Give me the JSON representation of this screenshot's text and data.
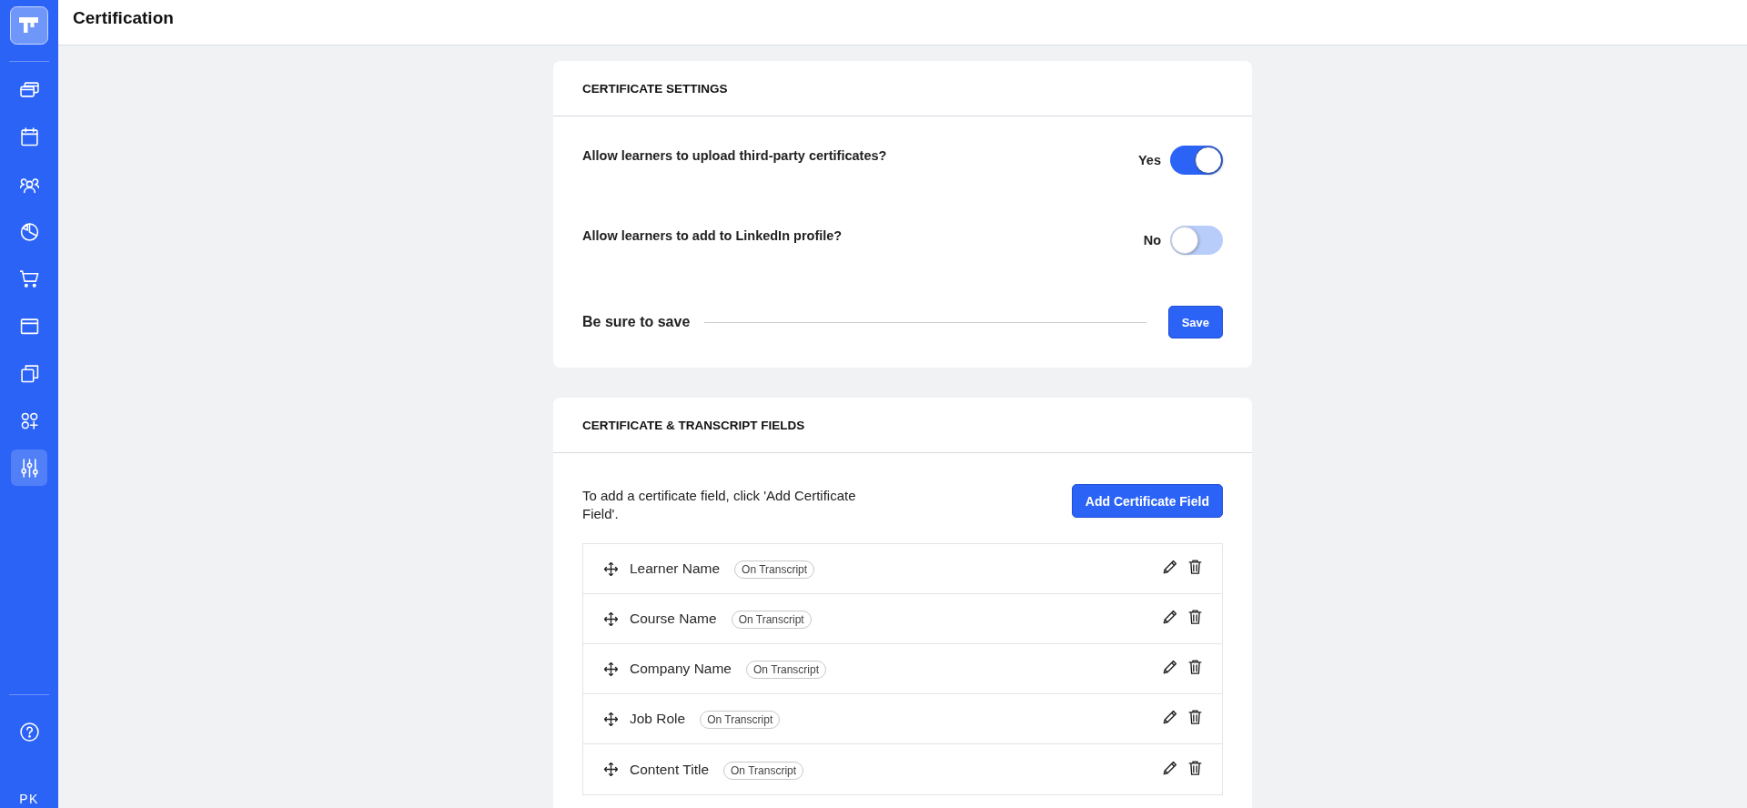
{
  "header": {
    "title": "Certification"
  },
  "sidebar": {
    "items": [
      {
        "selected": false
      },
      {
        "selected": false
      },
      {
        "selected": false
      },
      {
        "selected": false
      },
      {
        "selected": false
      },
      {
        "selected": false
      },
      {
        "selected": false
      },
      {
        "selected": false
      },
      {
        "selected": true
      }
    ],
    "user_initials": "PK"
  },
  "settings_card": {
    "title": "CERTIFICATE SETTINGS",
    "options": [
      {
        "label": "Allow learners to upload third-party certificates?",
        "state_text": "Yes",
        "on": true
      },
      {
        "label": "Allow learners to add to LinkedIn profile?",
        "state_text": "No",
        "on": false
      }
    ],
    "save_prompt": "Be sure to save",
    "save_button": "Save"
  },
  "fields_card": {
    "title": "CERTIFICATE & TRANSCRIPT FIELDS",
    "instructions": "To add a certificate field, click 'Add Certificate Field'.",
    "add_button": "Add Certificate Field",
    "fields": [
      {
        "name": "Learner Name",
        "badge": "On Transcript"
      },
      {
        "name": "Course Name",
        "badge": "On Transcript"
      },
      {
        "name": "Company Name",
        "badge": "On Transcript"
      },
      {
        "name": "Job Role",
        "badge": "On Transcript"
      },
      {
        "name": "Content Title",
        "badge": "On Transcript"
      }
    ]
  }
}
